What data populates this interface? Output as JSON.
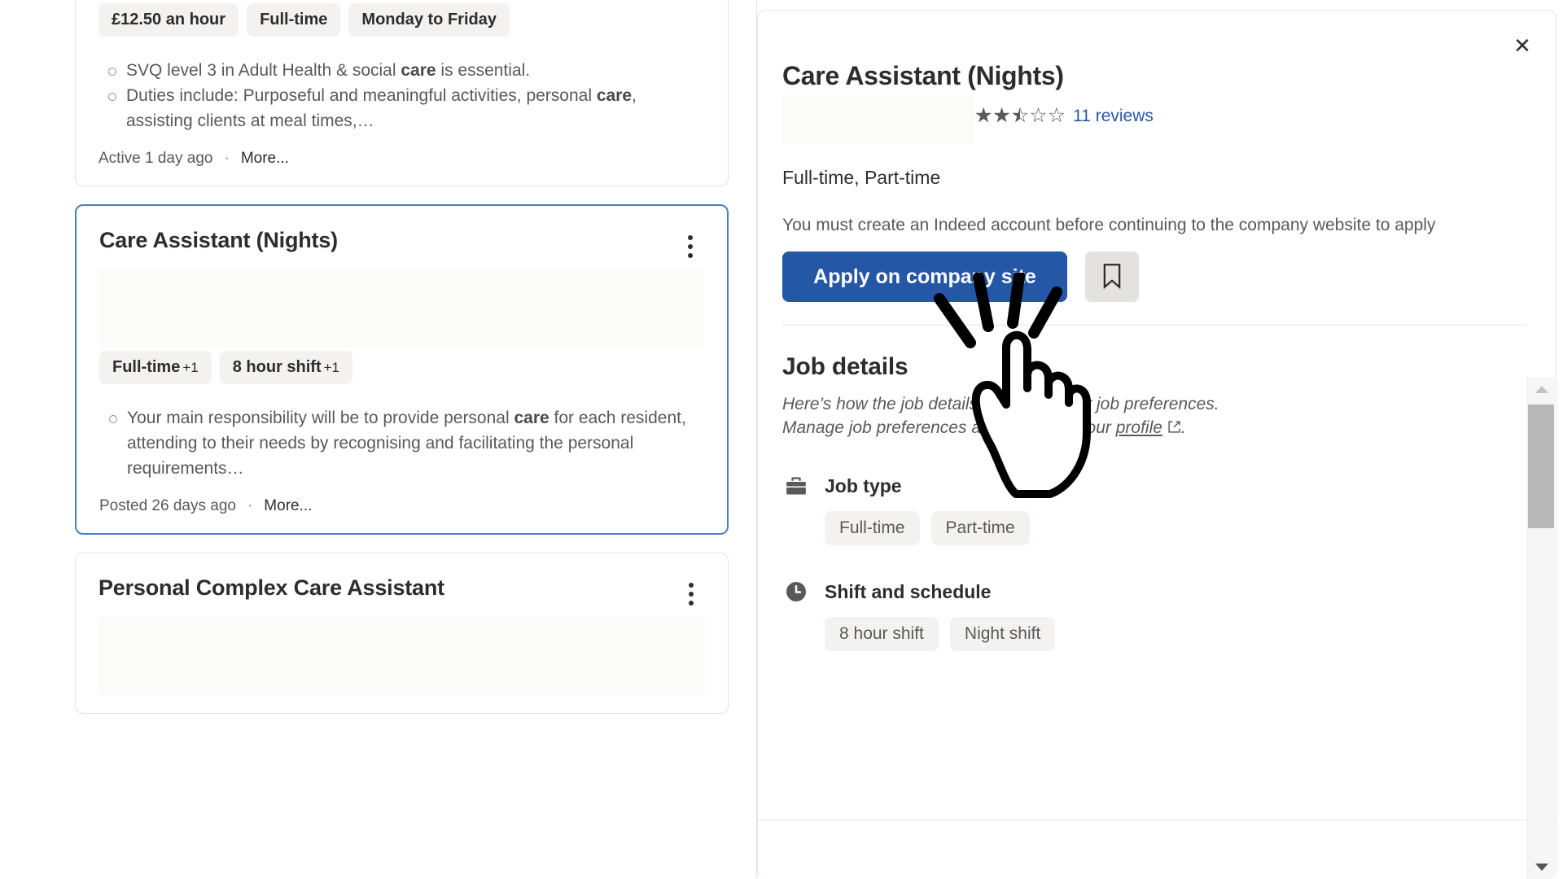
{
  "results": {
    "cards": [
      {
        "title": "",
        "pills": [
          {
            "label": "£12.50 an hour",
            "extra": ""
          },
          {
            "label": "Full-time",
            "extra": ""
          },
          {
            "label": "Monday to Friday",
            "extra": ""
          }
        ],
        "snippet": [
          {
            "pre": "SVQ level 3 in Adult Health & social ",
            "bold": "care",
            "post": " is essential."
          },
          {
            "pre": "Duties include: Purposeful and meaningful activities, personal ",
            "bold": "care",
            "post": ", assisting clients at meal times,…"
          }
        ],
        "posted": "Active 1 day ago",
        "separator": "·",
        "more": "More..."
      },
      {
        "title": "Care Assistant (Nights)",
        "pills": [
          {
            "label": "Full-time",
            "extra": "+1"
          },
          {
            "label": "8 hour shift",
            "extra": "+1"
          }
        ],
        "snippet": [
          {
            "pre": "Your main responsibility will be to provide personal ",
            "bold": "care",
            "post": " for each resident, attending to their needs by recognising and facilitating the personal requirements…"
          }
        ],
        "posted": "Posted 26 days ago",
        "separator": "·",
        "more": "More..."
      },
      {
        "title": "Personal Complex Care Assistant",
        "pills": [],
        "snippet": [],
        "posted": "",
        "separator": "",
        "more": ""
      }
    ]
  },
  "detail": {
    "close_label": "✕",
    "title": "Care Assistant (Nights)",
    "rating": {
      "value": 2.5,
      "max": 5,
      "reviews_label": "11 reviews"
    },
    "job_type_line": "Full-time, Part-time",
    "apply_note": "You must create an Indeed account before continuing to the company website to apply",
    "apply_button": "Apply on company site",
    "save_icon": "bookmark-icon",
    "details": {
      "heading": "Job details",
      "sub_line_1": "Here’s how the job details align with your job preferences.",
      "sub_line_2_pre": "Manage job preferences at any time in your ",
      "sub_line_2_link": "profile",
      "sub_line_2_post": ".",
      "groups": [
        {
          "icon": "briefcase-icon",
          "label": "Job type",
          "values": [
            "Full-time",
            "Part-time"
          ]
        },
        {
          "icon": "clock-icon",
          "label": "Shift and schedule",
          "values": [
            "8 hour shift",
            "Night shift"
          ]
        }
      ]
    },
    "scrollbar": {
      "up_icon": "triangle-up-icon",
      "down_icon": "triangle-down-icon"
    }
  },
  "colors": {
    "accent": "#2557a7",
    "link": "#2557a7",
    "selected_border": "#4a7fc1",
    "pill_bg": "#f3f2f1",
    "text": "#2d2d2d",
    "muted": "#595959",
    "border": "#e4e2e0"
  }
}
